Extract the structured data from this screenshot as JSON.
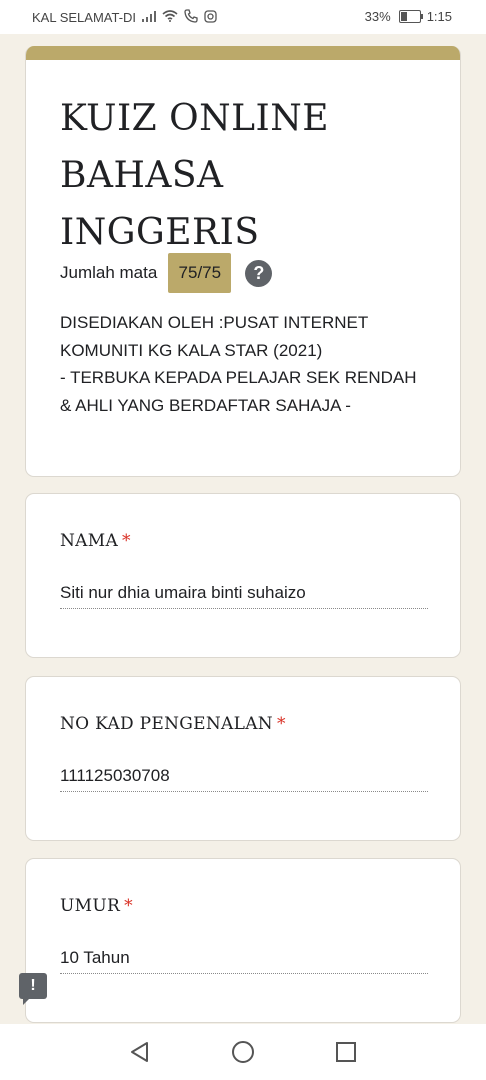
{
  "status_bar": {
    "carrier": "KAL SELAMAT-DI",
    "battery_percent": "33%",
    "time": "1:15",
    "icons": [
      "signal-icon",
      "wifi-icon",
      "call-icon",
      "instagram-icon",
      "battery-icon"
    ]
  },
  "form": {
    "title": "KUIZ ONLINE BAHASA INGGERIS",
    "points_label": "Jumlah mata",
    "points_value": "75/75",
    "description": "DISEDIAKAN OLEH :PUSAT INTERNET KOMUNITI KG KALA STAR (2021)\n- TERBUKA KEPADA PELAJAR SEK RENDAH  & AHLI YANG BERDAFTAR SAHAJA -",
    "accent_color": "#bba96a"
  },
  "questions": [
    {
      "label": "NAMA",
      "required_mark": "*",
      "answer": "Siti nur dhia umaira binti suhaizo"
    },
    {
      "label": "NO KAD PENGENALAN",
      "required_mark": "*",
      "answer": "111125030708"
    },
    {
      "label": "UMUR",
      "required_mark": "*",
      "answer": "10 Tahun"
    }
  ],
  "nav_bar": {
    "icons": [
      "back-icon",
      "home-icon",
      "recents-icon"
    ]
  }
}
